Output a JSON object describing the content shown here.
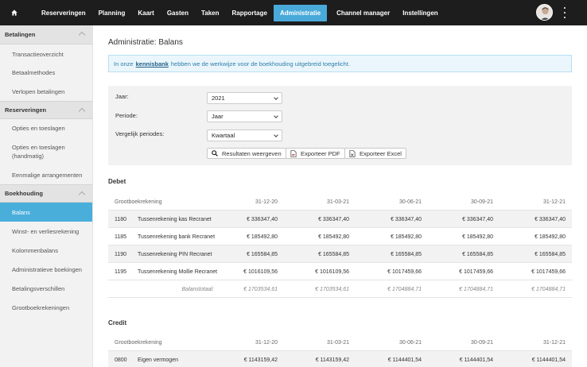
{
  "nav": {
    "items": [
      "Reserveringen",
      "Planning",
      "Kaart",
      "Gasten",
      "Taken",
      "Rapportage",
      "Administratie",
      "Channel manager",
      "Instellingen"
    ],
    "active": "Administratie"
  },
  "sidebar": {
    "sections": [
      {
        "title": "Betalingen",
        "items": [
          "Transactieoverzicht",
          "Betaalmethodes",
          "Verlopen betalingen"
        ]
      },
      {
        "title": "Reserveringen",
        "items": [
          "Opties en toeslagen",
          "Opties en toeslagen (handmatig)",
          "Eenmalige arrangementen"
        ]
      },
      {
        "title": "Boekhouding",
        "items": [
          "Balans",
          "Winst- en verliesrekening",
          "Kolommenbalans",
          "Administratieve boekingen",
          "Betalingsverschillen",
          "Grootboekrekeningen"
        ]
      }
    ],
    "active": "Balans",
    "opties_handmatig_line1": "Opties en toeslagen",
    "opties_handmatig_line2": "(handmatig)"
  },
  "page": {
    "title": "Administratie: Balans",
    "info_pre": "In onze",
    "info_link": "kennisbank",
    "info_post": "hebben we de werkwijze voor de boekhouding uitgebreid toegelicht."
  },
  "filters": {
    "jaar_label": "Jaar:",
    "jaar_value": "2021",
    "periode_label": "Periode:",
    "periode_value": "Jaar",
    "vergelijk_label": "Vergelijk periodes:",
    "vergelijk_value": "Kwartaal",
    "btn_results": "Resultaten weergeven",
    "btn_pdf": "Exporteer PDF",
    "btn_excel": "Exporteer Excel"
  },
  "debet": {
    "title": "Debet",
    "header": [
      "Grootboekrekening",
      "31-12-20",
      "31-03-21",
      "30-06-21",
      "30-09-21",
      "31-12-21"
    ],
    "rows": [
      {
        "code": "1180",
        "name": "Tussenrekening kas Recranet",
        "values": [
          "€ 336347,40",
          "€ 336347,40",
          "€ 336347,40",
          "€ 336347,40",
          "€ 336347,40"
        ]
      },
      {
        "code": "1185",
        "name": "Tussenrekening bank Recranet",
        "values": [
          "€ 185492,80",
          "€ 185492,80",
          "€ 185492,80",
          "€ 185492,80",
          "€ 185492,80"
        ]
      },
      {
        "code": "1190",
        "name": "Tussenrekening PIN Recranet",
        "values": [
          "€ 165584,85",
          "€ 165584,85",
          "€ 165584,85",
          "€ 165584,85",
          "€ 165584,85"
        ]
      },
      {
        "code": "1195",
        "name": "Tussenrekening Mollie Recranet",
        "values": [
          "€ 1016109,56",
          "€ 1016109,56",
          "€ 1017459,66",
          "€ 1017459,66",
          "€ 1017459,66"
        ]
      }
    ],
    "total_label": "Balanstotaal:",
    "totals": [
      "€ 1703534,61",
      "€ 1703534,61",
      "€ 1704884,71",
      "€ 1704884,71",
      "€ 1704884,71"
    ]
  },
  "credit": {
    "title": "Credit",
    "header": [
      "Grootboekrekening",
      "31-12-20",
      "31-03-21",
      "30-06-21",
      "30-09-21",
      "31-12-21"
    ],
    "rows": [
      {
        "code": "0800",
        "name": "Eigen vermogen",
        "values": [
          "€ 1143159,42",
          "€ 1143159,42",
          "€ 1144401,54",
          "€ 1144401,54",
          "€ 1144401,54"
        ]
      }
    ]
  },
  "colors": {
    "nav_bg": "#1d1d1d",
    "accent": "#4aaedb",
    "info_bg": "#eaf6fc"
  },
  "icons": {
    "home": "home-icon",
    "search": "search-icon",
    "pdf": "document-icon",
    "excel": "document-icon",
    "menu": "kebab-menu-icon"
  }
}
